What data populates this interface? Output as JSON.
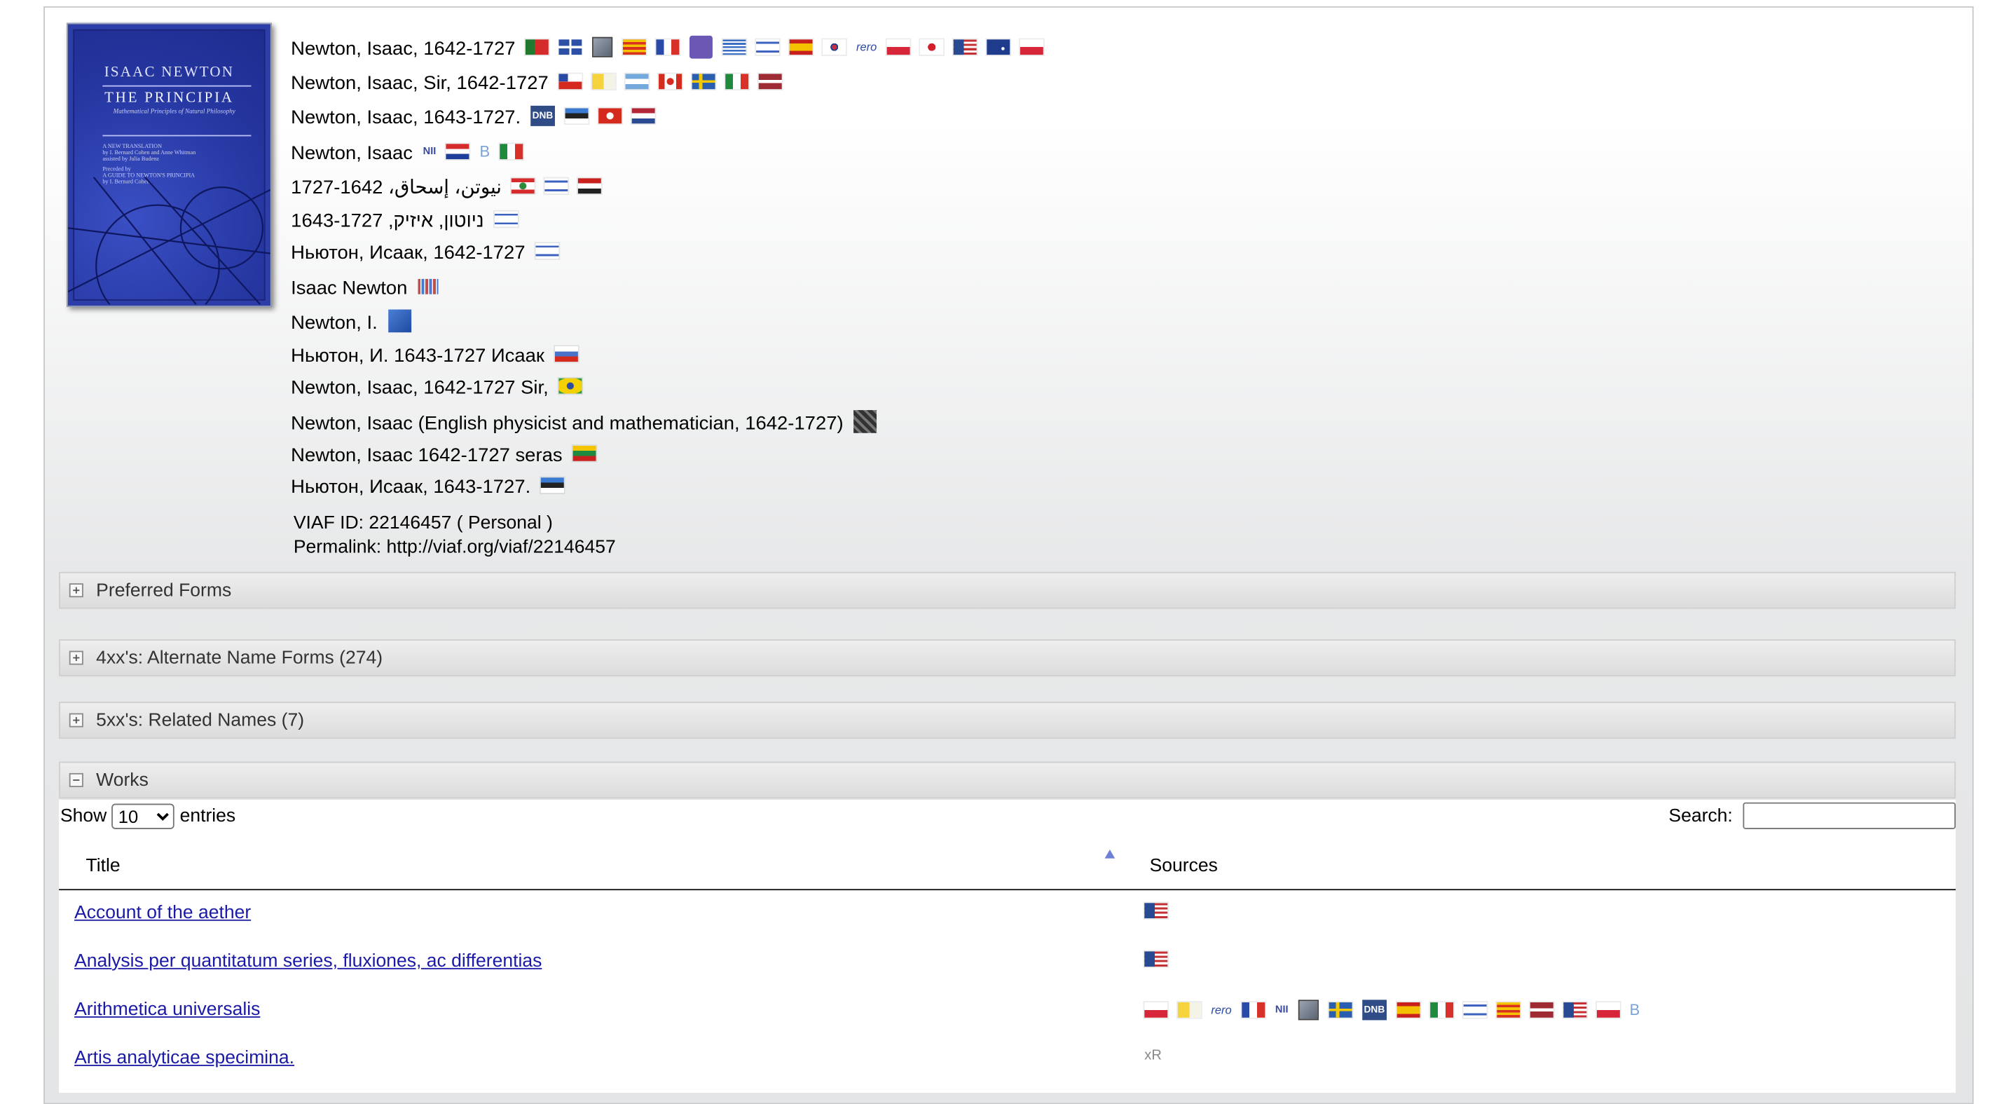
{
  "cover": {
    "author": "ISAAC NEWTON",
    "title": "THE PRINCIPIA",
    "subtitle": "Mathematical Principles of Natural Philosophy",
    "line1": "A NEW TRANSLATION",
    "line2": "by I. Bernard Cohen and Anne Whitman",
    "line3": "assisted by Julia Budenz",
    "line4": "Preceded by",
    "line5": "A GUIDE TO NEWTON'S PRINCIPIA",
    "line6": "by I. Bernard Cohen"
  },
  "names": [
    {
      "text": "Newton, Isaac, 1642-1727",
      "icons": [
        "flag-portugal",
        "tiles",
        "book",
        "flag-catalonia",
        "flag-france",
        "nukat",
        "flag-greece",
        "flag-israel",
        "flag-spain",
        "flag-korea",
        "rero",
        "flag-poland",
        "flag-japan",
        "flag-usa",
        "flag-australia",
        "flag-czech"
      ]
    },
    {
      "text": "Newton, Isaac, Sir, 1642-1727",
      "icons": [
        "flag-chile",
        "flag-vatican",
        "flag-argentina",
        "flag-canada",
        "flag-sweden",
        "flag-italy",
        "flag-latvia"
      ]
    },
    {
      "text": "Newton, Isaac, 1643-1727.",
      "icons": [
        "dnb",
        "flag-estonia",
        "flag-switzerland",
        "flag-netherlands"
      ]
    },
    {
      "text": "Newton, Isaac",
      "icons": [
        "nii",
        "flag-croatia",
        "letter-b",
        "flag-italy"
      ]
    },
    {
      "text": "نيوتن، إسحاق، 1642-1727",
      "icons": [
        "flag-lebanon",
        "flag-israel",
        "flag-egypt"
      ]
    },
    {
      "text": "ניוטון, איזיק, 1643-1727",
      "icons": [
        "flag-israel"
      ]
    },
    {
      "text": "Ньютон, Исаак, 1642-1727",
      "icons": [
        "flag-israel"
      ]
    },
    {
      "text": "Isaac Newton",
      "icons": [
        "barcode"
      ]
    },
    {
      "text": "Newton, I.",
      "icons": [
        "blue-square"
      ]
    },
    {
      "text": "Ньютон, И. 1643-1727 Исаак",
      "icons": [
        "flag-russia"
      ]
    },
    {
      "text": "Newton, Isaac, 1642-1727 Sir,",
      "icons": [
        "flag-brazil"
      ]
    },
    {
      "text": "Newton, Isaac (English physicist and mathematician, 1642-1727)",
      "icons": [
        "dark-square"
      ]
    },
    {
      "text": "Newton, Isaac 1642-1727 seras",
      "icons": [
        "flag-lithuania"
      ]
    },
    {
      "text": "Ньютон, Исаак, 1643-1727.",
      "icons": [
        "flag-estonia"
      ]
    }
  ],
  "meta": {
    "viaf_id": "VIAF ID: 22146457 ( Personal )",
    "permalink": "Permalink: http://viaf.org/viaf/22146457"
  },
  "sections": {
    "preferred": "Preferred Forms",
    "alternate": "4xx's: Alternate Name Forms (274)",
    "related": "5xx's: Related Names (7)",
    "works": "Works"
  },
  "works_table": {
    "show_label": "Show",
    "entries_value": "10",
    "entries_label": "entries",
    "search_label": "Search:",
    "search_value": "",
    "col_title": "Title",
    "col_sources": "Sources",
    "rows": [
      {
        "title": "Account of the aether",
        "sources": [
          "flag-usa"
        ]
      },
      {
        "title": "Analysis per quantitatum series, fluxiones, ac differentias",
        "sources": [
          "flag-usa"
        ]
      },
      {
        "title": "Arithmetica universalis",
        "sources": [
          "flag-poland",
          "flag-vatican",
          "rero",
          "flag-france",
          "nii",
          "book",
          "flag-sweden",
          "dnb",
          "flag-spain",
          "flag-italy",
          "flag-israel",
          "flag-catalonia",
          "flag-latvia",
          "flag-usa",
          "flag-czech",
          "letter-b"
        ]
      },
      {
        "title": "Artis analyticae specimina.",
        "sources": [
          "xr"
        ]
      }
    ]
  },
  "icon_text": {
    "rero": "rero",
    "nii": "NII",
    "dnb": "DNB",
    "letter-b": "B",
    "xr": "xR"
  }
}
